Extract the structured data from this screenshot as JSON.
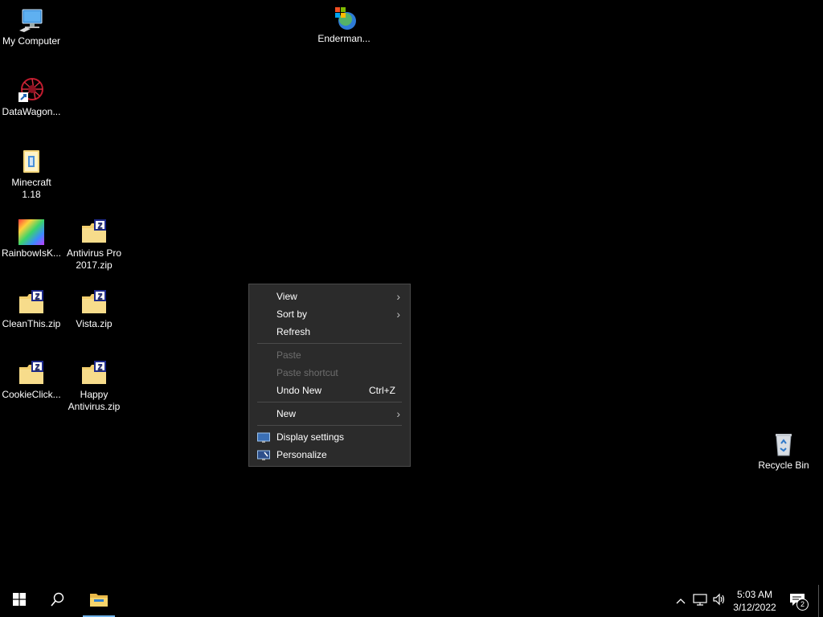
{
  "desktop_icons": {
    "my_computer": "My Computer",
    "enderman": "Enderman...",
    "datawagon": "DataWagon...",
    "minecraft": "Minecraft\n1.18",
    "rainbowisk": "RainbowIsK...",
    "antivirus_pro": "Antivirus Pro\n2017.zip",
    "cleanthis": "CleanThis.zip",
    "vista": "Vista.zip",
    "cookieclick": "CookieClick...",
    "happy_antivirus": "Happy\nAntivirus.zip",
    "recycle_bin": "Recycle Bin"
  },
  "context_menu": {
    "view": "View",
    "sort_by": "Sort by",
    "refresh": "Refresh",
    "paste": "Paste",
    "paste_shortcut": "Paste shortcut",
    "undo_new": "Undo New",
    "undo_shortcut": "Ctrl+Z",
    "new": "New",
    "display_settings": "Display settings",
    "personalize": "Personalize"
  },
  "taskbar": {
    "start_icon": "windows-logo-icon",
    "search_icon": "search-icon",
    "explorer_icon": "file-explorer-icon",
    "clock_time": "5:03 AM",
    "clock_date": "3/12/2022",
    "notification_count": "2"
  },
  "colors": {
    "desktop_bg": "#000000",
    "menu_bg": "#2b2b2b",
    "accent_underline": "#6fb2ea"
  }
}
